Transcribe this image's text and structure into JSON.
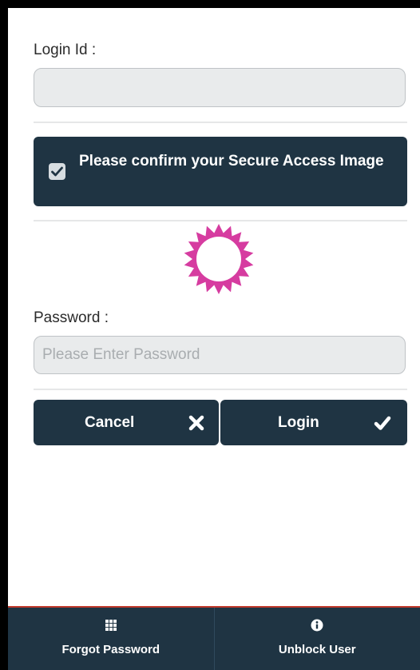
{
  "login_id": {
    "label": "Login Id :",
    "value": "",
    "placeholder": ""
  },
  "secure_access": {
    "text": "Please confirm your Secure Access Image",
    "checked": true,
    "image_icon": "sun-gear-icon",
    "image_color": "#d63ca0"
  },
  "password": {
    "label": "Password :",
    "placeholder": "Please Enter Password"
  },
  "buttons": {
    "cancel": {
      "label": "Cancel",
      "icon": "close-icon"
    },
    "login": {
      "label": "Login",
      "icon": "check-icon"
    }
  },
  "bottom_nav": {
    "forgot_password": {
      "label": "Forgot Password",
      "icon": "grid-icon"
    },
    "unblock_user": {
      "label": "Unblock User",
      "icon": "info-icon"
    }
  },
  "colors": {
    "primary": "#1f3443",
    "accent": "#d63ca0",
    "bottom_border": "#c0392b"
  }
}
